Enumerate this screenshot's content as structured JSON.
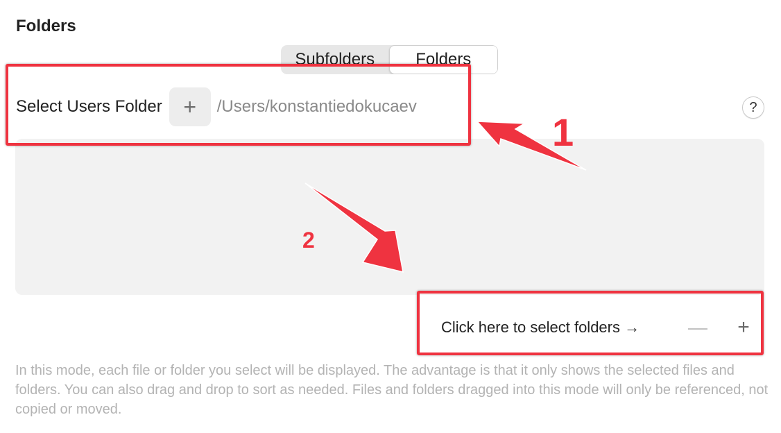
{
  "section": {
    "title": "Folders"
  },
  "segmented": {
    "options": [
      "Subfolders",
      "Folders"
    ],
    "selected": "Folders"
  },
  "folder_select": {
    "label": "Select Users Folder",
    "add_icon": "plus-icon",
    "path": "/Users/konstantiedokucaev"
  },
  "help": {
    "label": "?"
  },
  "actions": {
    "select_link": "Click here to select folders →",
    "remove_label": "—",
    "add_label": "+"
  },
  "description": "In this mode, each file or folder you select will be displayed. The advantage is that it only shows the selected files and folders. You can also drag and drop to sort as needed. Files and folders dragged into this mode will only be referenced, not copied or moved.",
  "annotations": {
    "marker_1": "1",
    "marker_2": "2",
    "color": "#ef3340"
  }
}
